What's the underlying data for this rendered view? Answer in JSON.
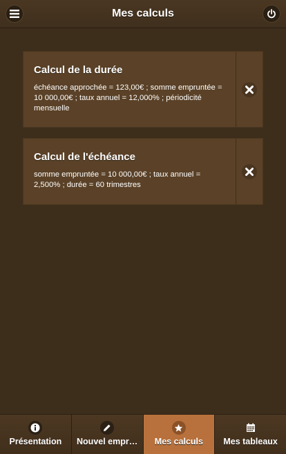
{
  "header": {
    "title": "Mes calculs"
  },
  "calculations": [
    {
      "title": "Calcul de la durée",
      "description": "échéance approchée = 123,00€ ; somme empruntée = 10 000,00€ ; taux annuel = 12,000% ; périodicité mensuelle"
    },
    {
      "title": "Calcul de l'échéance",
      "description": "somme empruntée = 10 000,00€ ; taux annuel = 2,500% ; durée = 60 trimestres"
    }
  ],
  "navbar": {
    "items": [
      {
        "label": "Présentation",
        "icon": "info-icon"
      },
      {
        "label": "Nouvel empr…",
        "icon": "pencil-icon"
      },
      {
        "label": "Mes calculs",
        "icon": "star-icon",
        "active": true
      },
      {
        "label": "Mes tableaux",
        "icon": "calendar-icon"
      }
    ]
  },
  "colors": {
    "background": "#3d2e1c",
    "card": "#5a4127",
    "active_tab": "#b8713c"
  }
}
